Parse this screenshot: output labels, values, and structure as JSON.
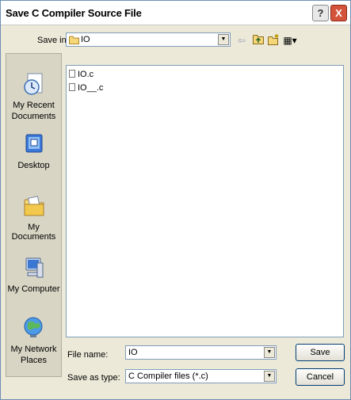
{
  "window": {
    "title": "Save C Compiler Source File",
    "help_glyph": "?",
    "close_glyph": "X"
  },
  "toolbar": {
    "save_in_label": "Save in:",
    "save_in_value": "IO",
    "back_glyph": "⇦",
    "up_glyph": "⬆",
    "newfolder_glyph": "✱",
    "views_glyph": "▦▾"
  },
  "places": [
    {
      "label_line1": "My Recent",
      "label_line2": "Documents",
      "icon": "recent-documents-icon"
    },
    {
      "label_line1": "Desktop",
      "label_line2": "",
      "icon": "desktop-icon"
    },
    {
      "label_line1": "My Documents",
      "label_line2": "",
      "icon": "my-documents-icon"
    },
    {
      "label_line1": "My Computer",
      "label_line2": "",
      "icon": "my-computer-icon"
    },
    {
      "label_line1": "My Network",
      "label_line2": "Places",
      "icon": "network-places-icon"
    }
  ],
  "files": [
    "IO.c",
    "IO__.c"
  ],
  "form": {
    "file_name_label": "File name:",
    "file_name_value": "IO",
    "save_as_type_label": "Save as type:",
    "save_as_type_value": "C Compiler files (*.c)"
  },
  "buttons": {
    "save": "Save",
    "cancel": "Cancel"
  },
  "colors": {
    "dialog_bg": "#ece9d8",
    "close_button": "#d3543b",
    "field_border": "#7f9db9"
  }
}
